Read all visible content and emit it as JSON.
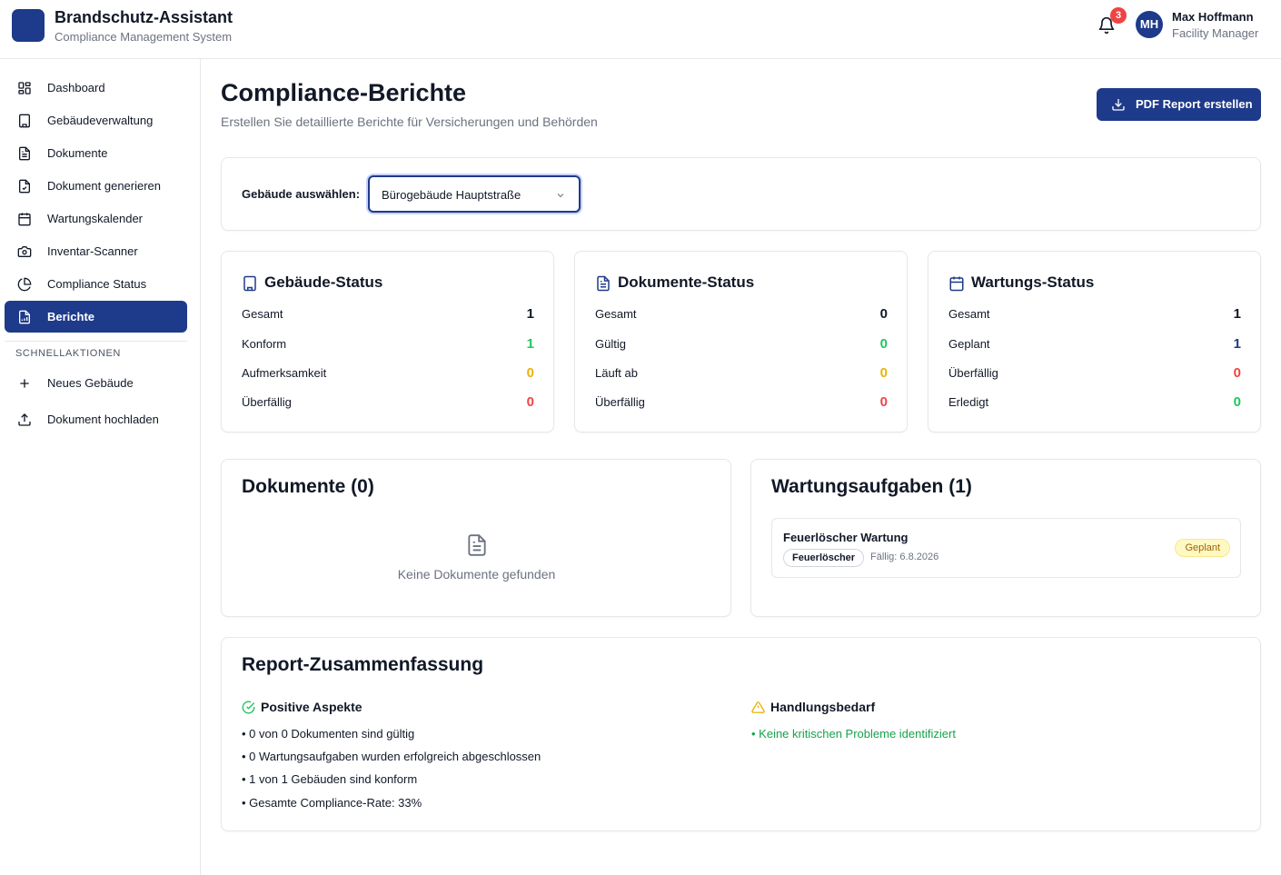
{
  "header": {
    "app_title": "Brandschutz-Assistant",
    "app_subtitle": "Compliance Management System",
    "notification_count": "3",
    "user_initials": "MH",
    "user_name": "Max Hoffmann",
    "user_role": "Facility Manager"
  },
  "sidebar": {
    "items": [
      {
        "label": "Dashboard",
        "icon": "dashboard-icon",
        "active": false
      },
      {
        "label": "Gebäudeverwaltung",
        "icon": "building-icon",
        "active": false
      },
      {
        "label": "Dokumente",
        "icon": "document-icon",
        "active": false
      },
      {
        "label": "Dokument generieren",
        "icon": "document-generate-icon",
        "active": false
      },
      {
        "label": "Wartungskalender",
        "icon": "calendar-icon",
        "active": false
      },
      {
        "label": "Inventar-Scanner",
        "icon": "camera-icon",
        "active": false
      },
      {
        "label": "Compliance Status",
        "icon": "pie-chart-icon",
        "active": false
      },
      {
        "label": "Berichte",
        "icon": "report-icon",
        "active": true
      }
    ],
    "quick_actions_title": "SCHNELLAKTIONEN",
    "quick_actions": [
      {
        "label": "Neues Gebäude",
        "icon": "plus-icon"
      },
      {
        "label": "Dokument hochladen",
        "icon": "upload-icon"
      }
    ]
  },
  "page": {
    "title": "Compliance-Berichte",
    "subtitle": "Erstellen Sie detaillierte Berichte für Versicherungen und Behörden",
    "pdf_button": "PDF Report erstellen"
  },
  "building_select": {
    "label": "Gebäude auswählen:",
    "value": "Bürogebäude Hauptstraße"
  },
  "stats": [
    {
      "title": "Gebäude-Status",
      "icon": "building-icon",
      "rows": [
        {
          "label": "Gesamt",
          "value": "1",
          "color": "#111827"
        },
        {
          "label": "Konform",
          "value": "1",
          "color": "#22c55e"
        },
        {
          "label": "Aufmerksamkeit",
          "value": "0",
          "color": "#eab308"
        },
        {
          "label": "Überfällig",
          "value": "0",
          "color": "#ef4444"
        }
      ]
    },
    {
      "title": "Dokumente-Status",
      "icon": "document-icon",
      "rows": [
        {
          "label": "Gesamt",
          "value": "0",
          "color": "#111827"
        },
        {
          "label": "Gültig",
          "value": "0",
          "color": "#22c55e"
        },
        {
          "label": "Läuft ab",
          "value": "0",
          "color": "#eab308"
        },
        {
          "label": "Überfällig",
          "value": "0",
          "color": "#ef4444"
        }
      ]
    },
    {
      "title": "Wartungs-Status",
      "icon": "calendar-icon",
      "rows": [
        {
          "label": "Gesamt",
          "value": "1",
          "color": "#111827"
        },
        {
          "label": "Geplant",
          "value": "1",
          "color": "#1e3a8a"
        },
        {
          "label": "Überfällig",
          "value": "0",
          "color": "#ef4444"
        },
        {
          "label": "Erledigt",
          "value": "0",
          "color": "#22c55e"
        }
      ]
    }
  ],
  "documents": {
    "title": "Dokumente (0)",
    "empty_text": "Keine Dokumente gefunden"
  },
  "maintenance": {
    "title": "Wartungsaufgaben (1)",
    "tasks": [
      {
        "title": "Feuerlöscher Wartung",
        "tag": "Feuerlöscher",
        "due": "Fällig: 6.8.2026",
        "status": "Geplant"
      }
    ]
  },
  "summary": {
    "title": "Report-Zusammenfassung",
    "positive_title": "Positive Aspekte",
    "positive_items": [
      "• 0 von 0 Dokumenten sind gültig",
      "• 0 Wartungsaufgaben wurden erfolgreich abgeschlossen",
      "• 1 von 1 Gebäuden sind konform",
      "• Gesamte Compliance-Rate: 33%"
    ],
    "action_title": "Handlungsbedarf",
    "action_items": [
      "• Keine kritischen Probleme identifiziert"
    ]
  },
  "colors": {
    "brand": "#1e3a8a",
    "green": "#22c55e",
    "yellow": "#eab308",
    "red": "#ef4444"
  }
}
